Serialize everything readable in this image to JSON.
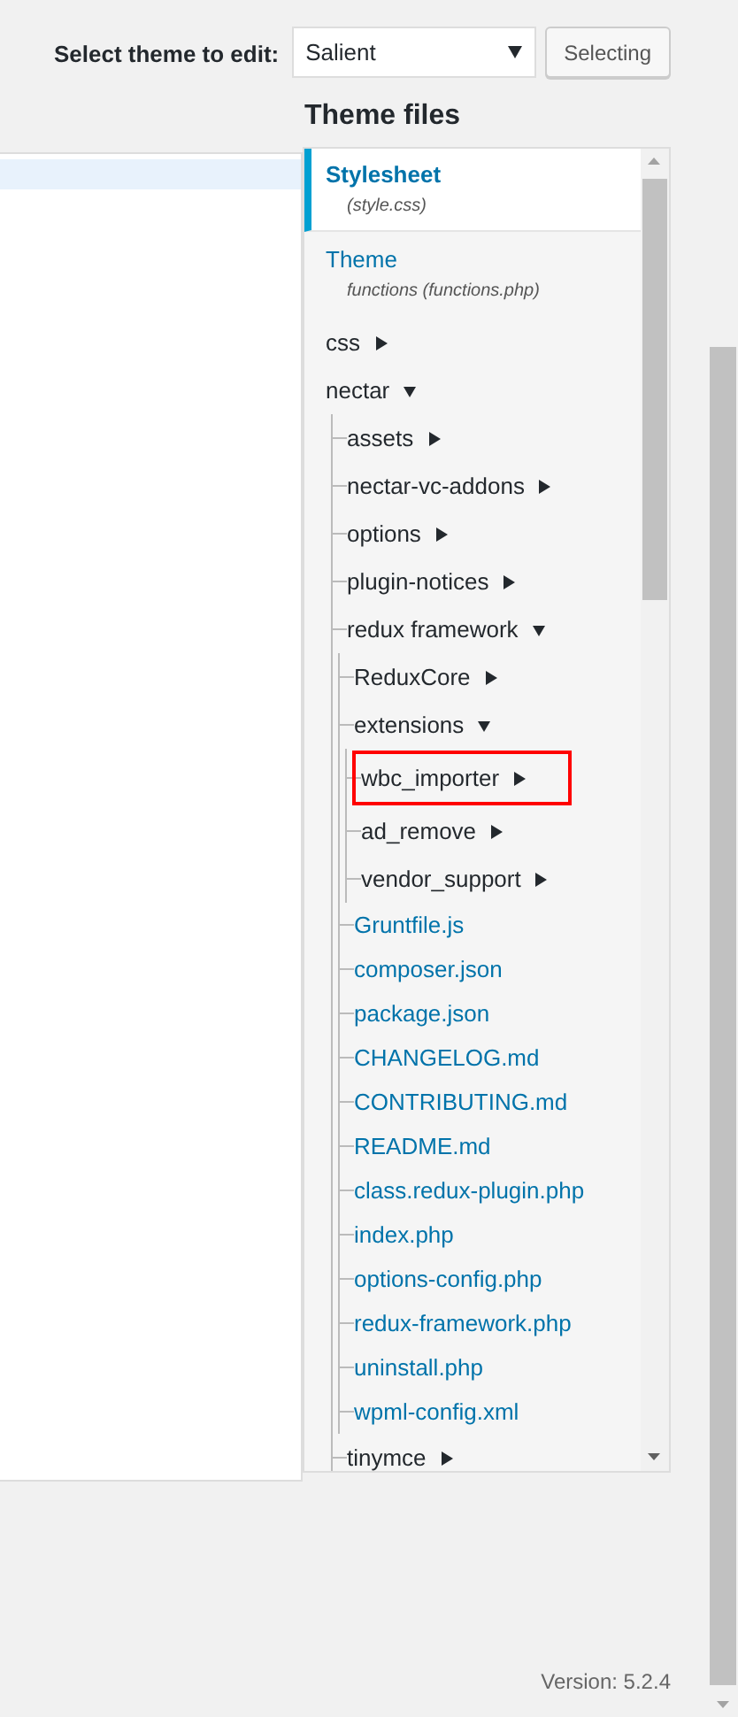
{
  "header": {
    "label": "Select theme to edit:",
    "theme_select": {
      "value": "Salient"
    },
    "button": "Selecting"
  },
  "editor": {
    "current_line_highlighted": true
  },
  "theme_files": {
    "title": "Theme files",
    "items": [
      {
        "kind": "template",
        "label": "Stylesheet",
        "file": "(style.css)",
        "selected": true
      },
      {
        "kind": "template",
        "label": "Theme",
        "file": "functions (functions.php)",
        "selected": false
      },
      {
        "kind": "folder",
        "label": "css",
        "expanded": false,
        "selected": false,
        "highlighted": false
      },
      {
        "kind": "folder",
        "label": "nectar",
        "expanded": true,
        "selected": false,
        "highlighted": false,
        "children": [
          {
            "kind": "folder",
            "label": "assets",
            "expanded": false,
            "selected": false,
            "highlighted": false
          },
          {
            "kind": "folder",
            "label": "nectar-vc-addons",
            "expanded": false,
            "selected": false,
            "highlighted": false
          },
          {
            "kind": "folder",
            "label": "options",
            "expanded": false,
            "selected": false,
            "highlighted": false
          },
          {
            "kind": "folder",
            "label": "plugin-notices",
            "expanded": false,
            "selected": false,
            "highlighted": false
          },
          {
            "kind": "folder",
            "label": "redux framework",
            "expanded": true,
            "selected": false,
            "highlighted": false,
            "children": [
              {
                "kind": "folder",
                "label": "ReduxCore",
                "expanded": false,
                "selected": false,
                "highlighted": false
              },
              {
                "kind": "folder",
                "label": "extensions",
                "expanded": true,
                "selected": false,
                "highlighted": false,
                "children": [
                  {
                    "kind": "folder",
                    "label": "wbc_importer",
                    "expanded": false,
                    "selected": false,
                    "highlighted": true
                  },
                  {
                    "kind": "folder",
                    "label": "ad_remove",
                    "expanded": false,
                    "selected": false,
                    "highlighted": false
                  },
                  {
                    "kind": "folder",
                    "label": "vendor_support",
                    "expanded": false,
                    "selected": false,
                    "highlighted": false
                  }
                ]
              },
              {
                "kind": "file",
                "label": "Gruntfile.js",
                "selected": false,
                "highlighted": false
              },
              {
                "kind": "file",
                "label": "composer.json",
                "selected": false,
                "highlighted": false
              },
              {
                "kind": "file",
                "label": "package.json",
                "selected": false,
                "highlighted": false
              },
              {
                "kind": "file",
                "label": "CHANGELOG.md",
                "selected": false,
                "highlighted": false
              },
              {
                "kind": "file",
                "label": "CONTRIBUTING.md",
                "selected": false,
                "highlighted": false
              },
              {
                "kind": "file",
                "label": "README.md",
                "selected": false,
                "highlighted": false
              },
              {
                "kind": "file",
                "label": "class.redux-plugin.php",
                "selected": false,
                "highlighted": false
              },
              {
                "kind": "file",
                "label": "index.php",
                "selected": false,
                "highlighted": false
              },
              {
                "kind": "file",
                "label": "options-config.php",
                "selected": false,
                "highlighted": false
              },
              {
                "kind": "file",
                "label": "redux-framework.php",
                "selected": false,
                "highlighted": false
              },
              {
                "kind": "file",
                "label": "uninstall.php",
                "selected": false,
                "highlighted": false
              },
              {
                "kind": "file",
                "label": "wpml-config.xml",
                "selected": false,
                "highlighted": false
              }
            ]
          },
          {
            "kind": "folder",
            "label": "tinymce",
            "expanded": false,
            "selected": false,
            "highlighted": false
          }
        ]
      }
    ]
  },
  "footer": {
    "version": "Version: 5.2.4"
  }
}
